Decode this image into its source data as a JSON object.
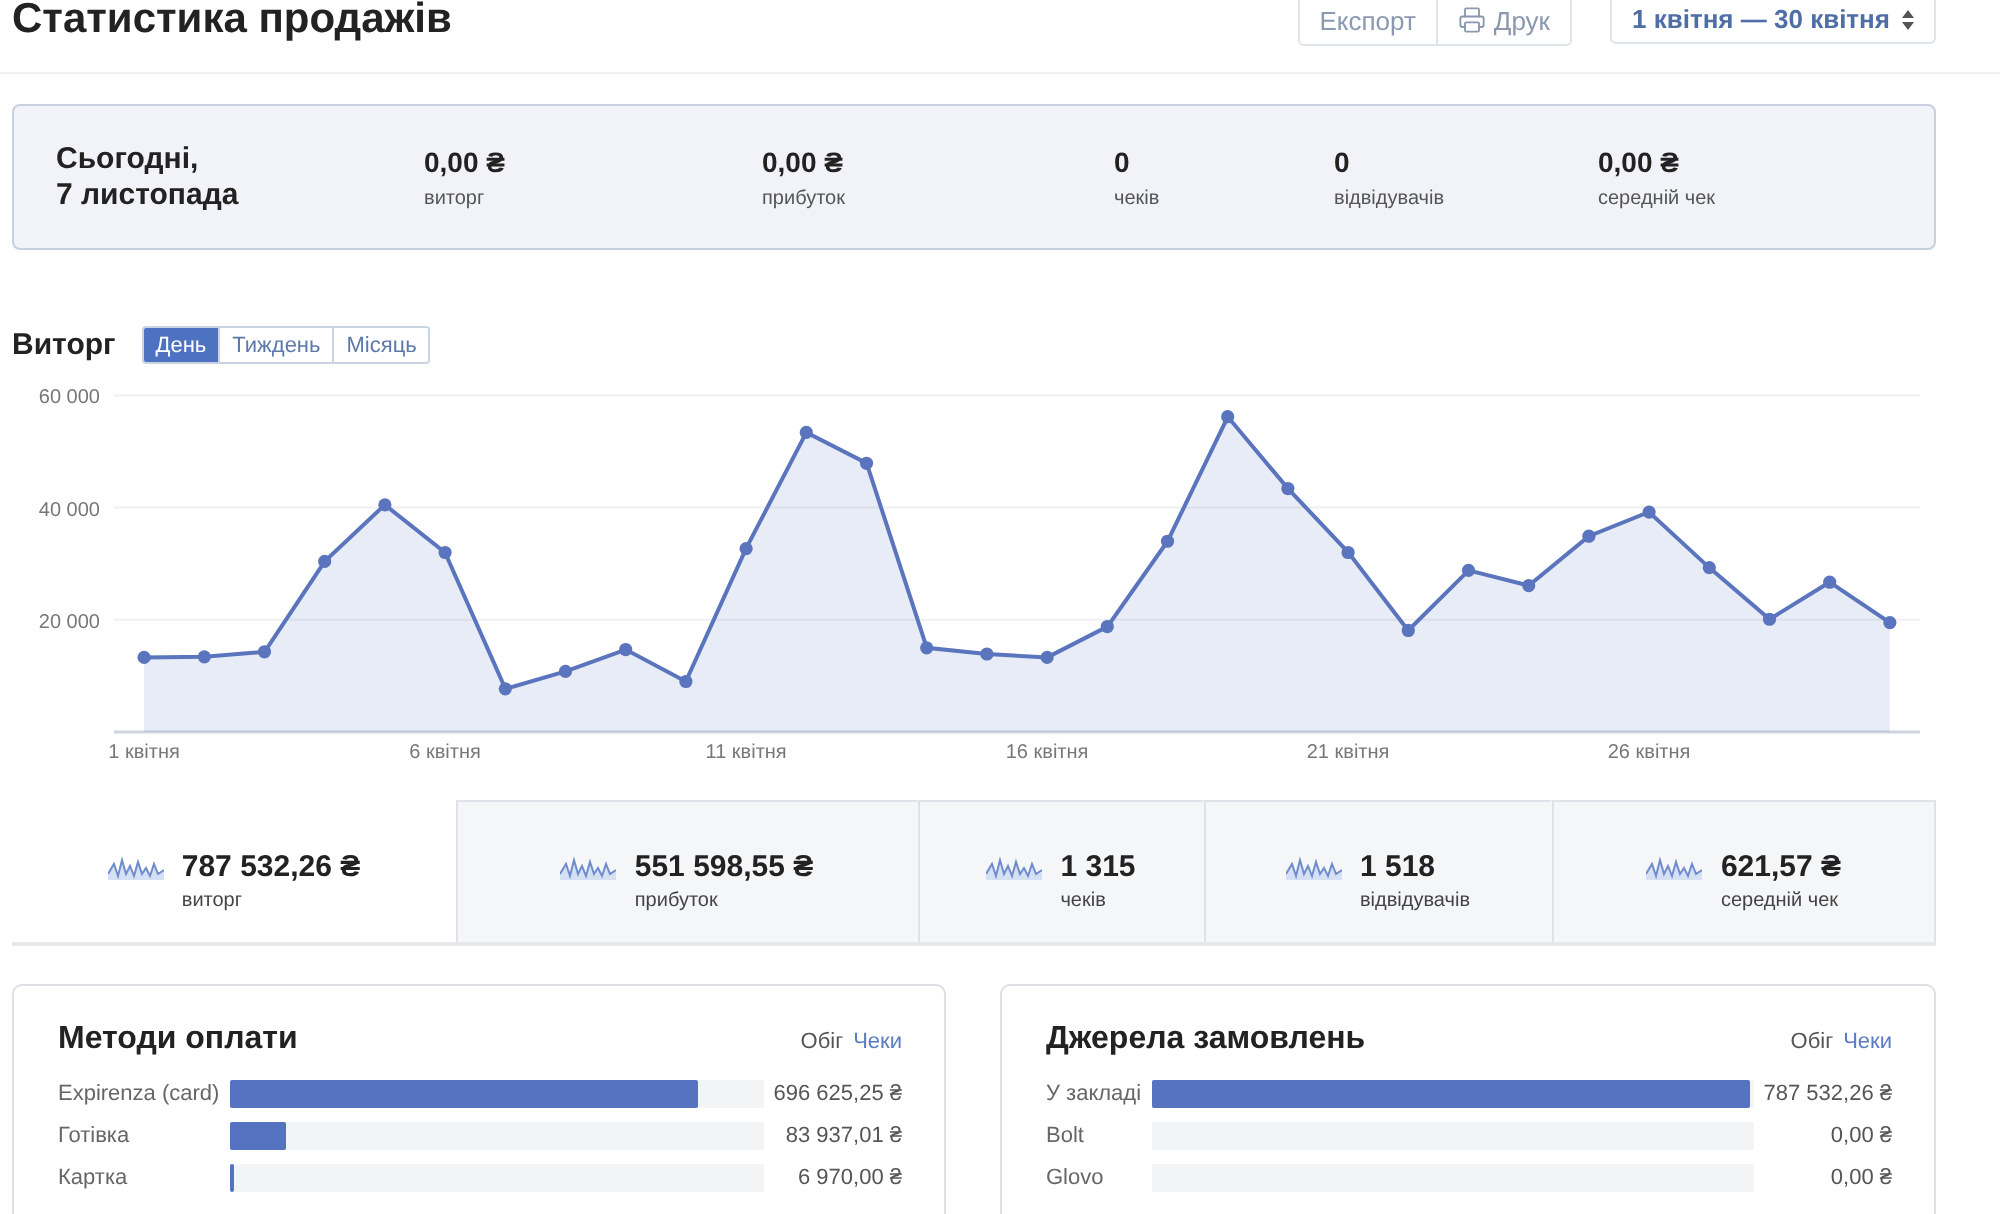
{
  "header": {
    "title": "Статистика продажів",
    "actions": [
      {
        "label": "Експорт",
        "kind": "text"
      },
      {
        "label": "Друк",
        "kind": "print"
      }
    ],
    "date_range": {
      "label": "1 квітня — 30 квітня"
    }
  },
  "today": {
    "day": "Сьогодні,",
    "date": "7 листопада",
    "stats": [
      {
        "value": "0,00 ₴",
        "label": "виторг"
      },
      {
        "value": "0,00 ₴",
        "label": "прибуток"
      },
      {
        "value": "0",
        "label": "чеків"
      },
      {
        "value": "0",
        "label": "відвідувачів"
      },
      {
        "value": "0,00 ₴",
        "label": "середній чек"
      }
    ]
  },
  "revenue_chart": {
    "periods": [
      {
        "label": "День",
        "selected": true
      },
      {
        "label": "Тиждень",
        "selected": false
      },
      {
        "label": "Місяць",
        "selected": false
      }
    ],
    "chart_data": {
      "type": "area",
      "title": "Виторг",
      "x": [
        1,
        2,
        3,
        4,
        5,
        6,
        7,
        8,
        9,
        10,
        11,
        12,
        13,
        14,
        15,
        16,
        17,
        18,
        19,
        20,
        21,
        22,
        23,
        24,
        25,
        26,
        27,
        28,
        29,
        30
      ],
      "series": [
        {
          "color": "#5a75bd",
          "values": [
            13300,
            13400,
            14300,
            30400,
            40500,
            32000,
            7700,
            10800,
            14700,
            9000,
            32700,
            53400,
            47900,
            15000,
            13900,
            13300,
            18800,
            34000,
            56200,
            43400,
            32000,
            18100,
            28800,
            26100,
            34900,
            39200,
            29300,
            20100,
            26700,
            19500
          ]
        }
      ],
      "xlim": [
        0.5,
        30.5
      ],
      "ylim": [
        0,
        60000
      ],
      "yticks": [
        {
          "value": 20000,
          "label": "20 000"
        },
        {
          "value": 40000,
          "label": "40 000"
        },
        {
          "value": 60000,
          "label": "60 000"
        }
      ],
      "xticks": [
        {
          "value": 1,
          "label": "1 квітня"
        },
        {
          "value": 6,
          "label": "6 квітня"
        },
        {
          "value": 11,
          "label": "11 квітня"
        },
        {
          "value": 16,
          "label": "16 квітня"
        },
        {
          "value": 21,
          "label": "21 квітня"
        },
        {
          "value": 26,
          "label": "26 квітня"
        }
      ]
    }
  },
  "totals": [
    {
      "value": "787 532,26 ₴",
      "label": "виторг",
      "selected": true
    },
    {
      "value": "551 598,55 ₴",
      "label": "прибуток",
      "selected": false
    },
    {
      "value": "1 315",
      "label": "чеків",
      "selected": false
    },
    {
      "value": "1 518",
      "label": "відвідувачів",
      "selected": false
    },
    {
      "value": "621,57 ₴",
      "label": "середній чек",
      "selected": false
    }
  ],
  "payment_methods": {
    "title": "Методи оплати",
    "modes": [
      {
        "label": "Обіг",
        "selected": true
      },
      {
        "label": "Чеки",
        "selected": false
      }
    ],
    "rows": [
      {
        "name": "Expirenza (card)",
        "level": 0.885,
        "amount": "696 625,25 ₴"
      },
      {
        "name": "Готівка",
        "level": 0.107,
        "amount": "83 937,01 ₴"
      },
      {
        "name": "Картка",
        "level": 0.009,
        "amount": "6 970,00 ₴"
      }
    ]
  },
  "order_sources": {
    "title": "Джерела замовлень",
    "modes": [
      {
        "label": "Обіг",
        "selected": true
      },
      {
        "label": "Чеки",
        "selected": false
      }
    ],
    "rows": [
      {
        "name": "У закладі",
        "level": 1,
        "amount": "787 532,26 ₴"
      },
      {
        "name": "Bolt",
        "amount": "0,00 ₴"
      },
      {
        "name": "Glovo",
        "amount": "0,00 ₴"
      }
    ]
  }
}
